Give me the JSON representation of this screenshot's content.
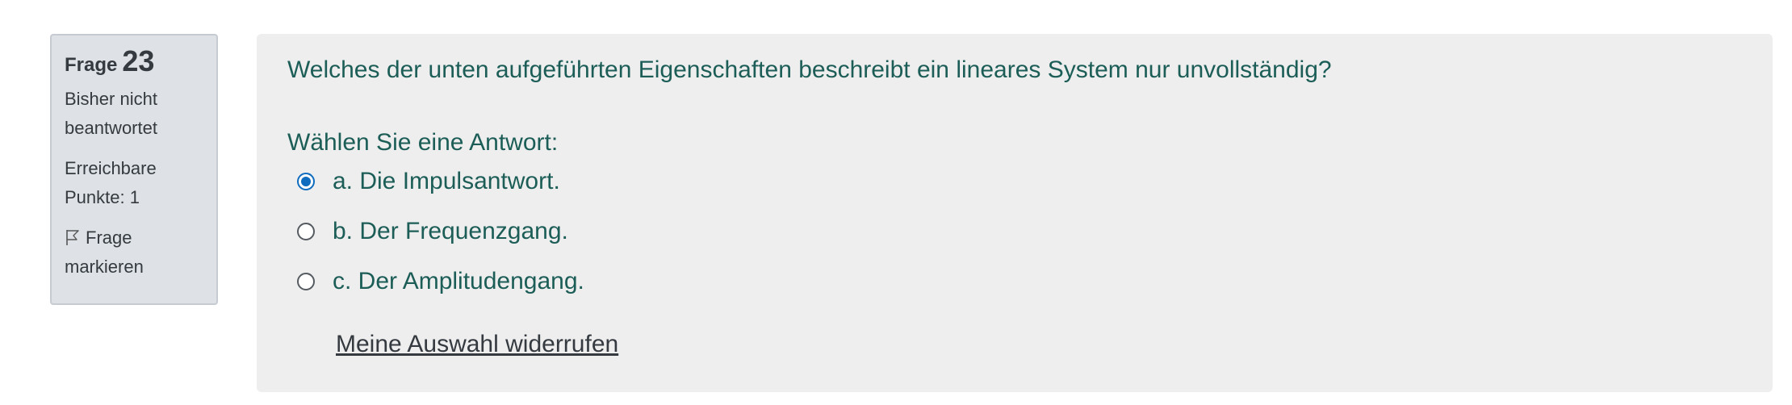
{
  "info": {
    "question_word": "Frage",
    "question_number": "23",
    "state_line1": "Bisher nicht",
    "state_line2": "beantwortet",
    "grade_line1": "Erreichbare",
    "grade_line2": "Punkte: 1",
    "flag_line1": "Frage",
    "flag_line2": "markieren",
    "flag_icon": "flag-outline-icon"
  },
  "question": {
    "text": "Welches der unten aufgeführten Eigenschaften beschreibt ein lineares System nur unvollständig?",
    "prompt": "Wählen Sie eine Antwort:",
    "options": [
      {
        "label": "a. Die Impulsantwort.",
        "selected": true
      },
      {
        "label": "b. Der Frequenzgang.",
        "selected": false
      },
      {
        "label": "c. Der Amplitudengang.",
        "selected": false
      }
    ],
    "clear_choice": "Meine Auswahl widerrufen"
  },
  "colors": {
    "question_text": "#1c5e57",
    "radio_selected": "#0f6cbf",
    "info_background": "#dee2e6",
    "content_background": "#eeeeee"
  }
}
